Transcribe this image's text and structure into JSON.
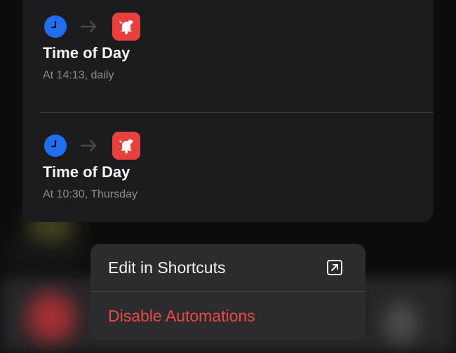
{
  "automations": [
    {
      "trigger_icon": "clock-icon",
      "action_icon": "alarm-bell-icon",
      "title": "Time of Day",
      "subtitle": "At 14:13, daily"
    },
    {
      "trigger_icon": "clock-icon",
      "action_icon": "alarm-bell-icon",
      "title": "Time of Day",
      "subtitle": "At 10:30, Thursday"
    }
  ],
  "context_menu": {
    "edit_label": "Edit in Shortcuts",
    "edit_icon": "open-external-icon",
    "disable_label": "Disable Automations"
  },
  "colors": {
    "card_bg": "#1c1c1e",
    "clock_blue": "#1f6ff0",
    "alarm_red": "#e8403d",
    "destructive_red": "#ec4a41",
    "menu_bg": "#2c2c2e"
  }
}
